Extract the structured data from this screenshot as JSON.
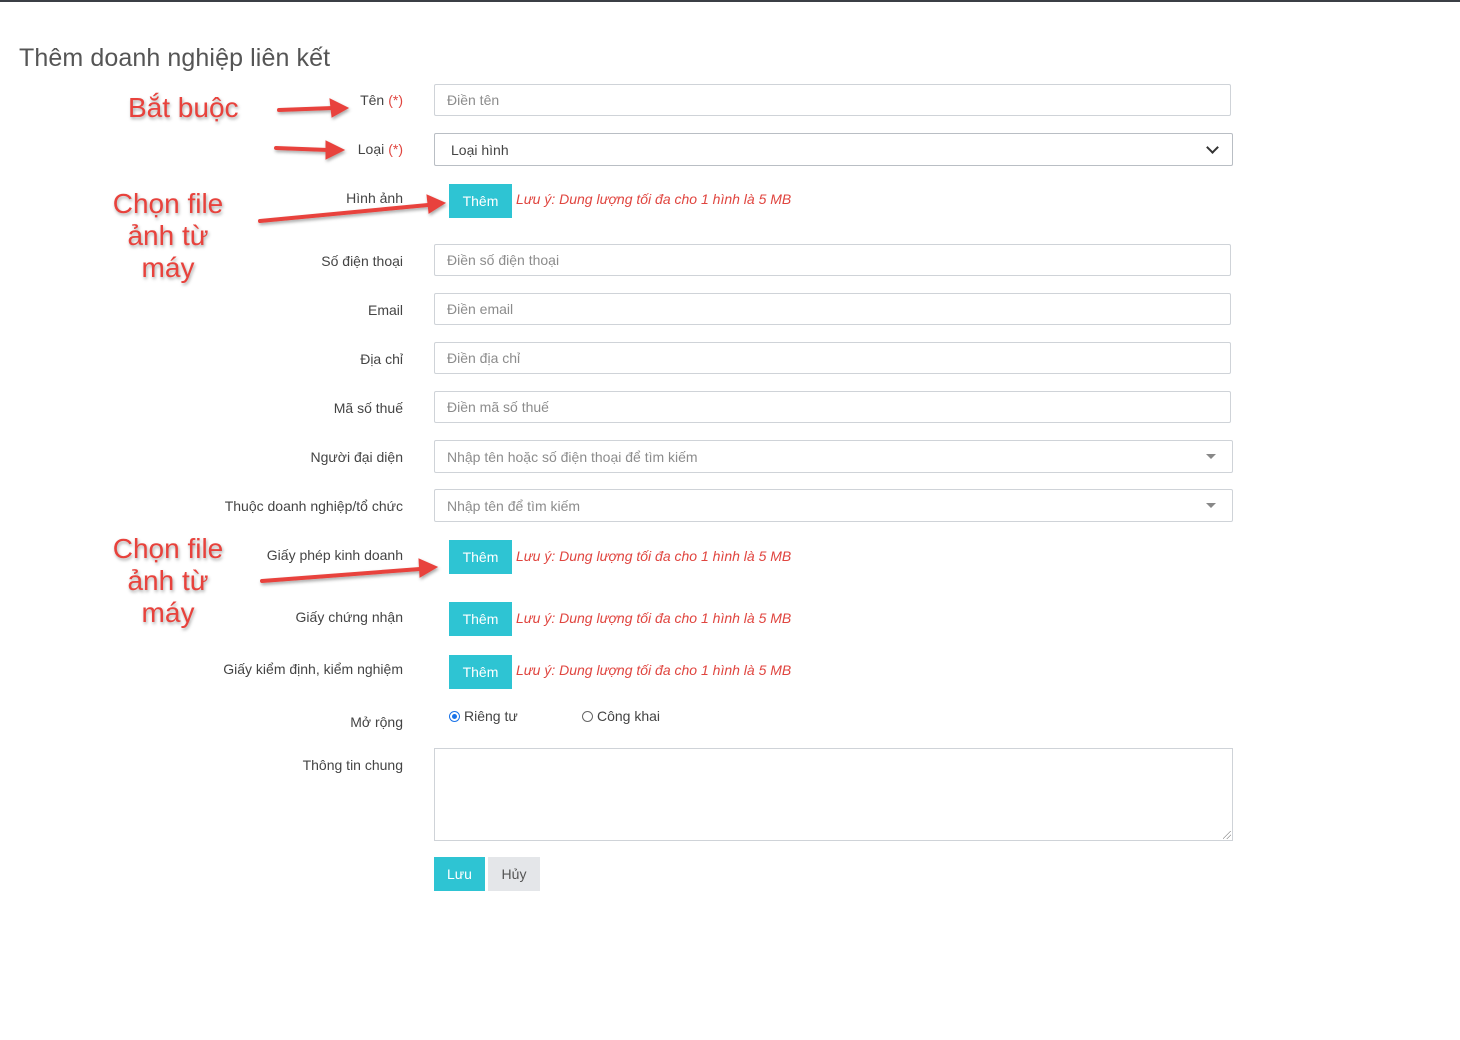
{
  "page": {
    "title": "Thêm doanh nghiệp liên kết"
  },
  "form": {
    "required_mark": "(*)",
    "name": {
      "label": "Tên",
      "placeholder": "Điền tên"
    },
    "type": {
      "label": "Loại",
      "selected": "Loại hình"
    },
    "image": {
      "label": "Hình ảnh",
      "button": "Thêm",
      "note": "Lưu ý: Dung lượng tối đa cho 1 hình là 5 MB"
    },
    "phone": {
      "label": "Số điện thoại",
      "placeholder": "Điền số điện thoại"
    },
    "email": {
      "label": "Email",
      "placeholder": "Điền email"
    },
    "address": {
      "label": "Địa chỉ",
      "placeholder": "Điền địa chỉ"
    },
    "tax": {
      "label": "Mã số thuế",
      "placeholder": "Điền mã số thuế"
    },
    "representative": {
      "label": "Người đại diện",
      "placeholder": "Nhập tên hoặc số điện thoại để tìm kiếm"
    },
    "parent_org": {
      "label": "Thuộc doanh nghiệp/tổ chức",
      "placeholder": "Nhập tên để tìm kiếm"
    },
    "business_license": {
      "label": "Giấy phép kinh doanh",
      "button": "Thêm",
      "note": "Lưu ý: Dung lượng tối đa cho 1 hình là 5 MB"
    },
    "certificate": {
      "label": "Giấy chứng nhận",
      "button": "Thêm",
      "note": "Lưu ý: Dung lượng tối đa cho 1 hình là 5 MB"
    },
    "inspection": {
      "label": "Giấy kiểm định, kiểm nghiệm",
      "button": "Thêm",
      "note": "Lưu ý: Dung lượng tối đa cho 1 hình là 5 MB"
    },
    "visibility": {
      "label": "Mở rộng",
      "options": [
        "Riêng tư",
        "Công khai"
      ],
      "selected": "Riêng tư"
    },
    "general_info": {
      "label": "Thông tin chung",
      "value": ""
    },
    "save_label": "Lưu",
    "cancel_label": "Hủy"
  },
  "annotations": {
    "required": "Bắt buộc",
    "choose_file_1": [
      "Chọn file",
      "ảnh từ",
      "máy"
    ],
    "choose_file_2": [
      "Chọn file",
      "ảnh từ",
      "máy"
    ]
  },
  "colors": {
    "accent": "#2ec4d3",
    "required_red": "#e0453f",
    "annotation_red": "#e8423c",
    "cancel_gray": "#e4e6e9"
  }
}
